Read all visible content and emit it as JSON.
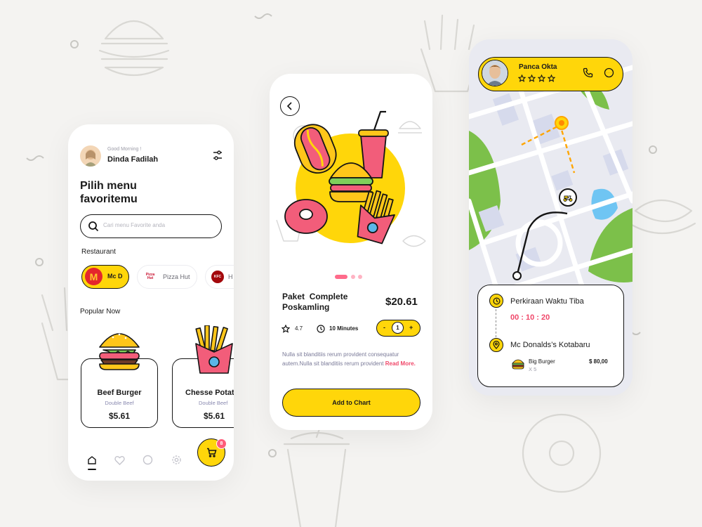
{
  "colors": {
    "accent": "#ffd60a",
    "dark": "#141414",
    "pink": "#ff4b6b",
    "muted": "#9a9aa6",
    "map_bg": "#e9eaf1",
    "park": "#7cc04a",
    "water": "#6fc5f3",
    "orange": "#ffa500"
  },
  "screen1": {
    "greeting": "Good Morning !",
    "user_name": "Dinda Fadilah",
    "title_line1": "Pilih menu",
    "title_line2": "favoritemu",
    "search_placeholder": "Cari menu Favorite anda",
    "restaurant_heading": "Restaurant",
    "restaurants": [
      {
        "logo": "M",
        "name": "Mc D",
        "selected": true
      },
      {
        "logo": "Pizza Hut",
        "name": "Pizza Hut",
        "selected": false
      },
      {
        "logo": "KFC",
        "name": "H",
        "selected": false
      }
    ],
    "popular_heading": "Popular Now",
    "products": [
      {
        "name": "Beef Burger",
        "sub": "Double Beef",
        "price": "$5.61"
      },
      {
        "name": "Chesse Potato",
        "sub": "Double Beef",
        "price": "$5.61"
      }
    ],
    "cart_badge": "8",
    "nav_icons": [
      "home-icon",
      "heart-icon",
      "chat-icon",
      "gear-icon",
      "cart-icon"
    ]
  },
  "screen2": {
    "product_title_line1": "Paket  Complete",
    "product_title_line2": "Poskamling",
    "price": "$20.61",
    "rating": "4.7",
    "time": "10 Minutes",
    "quantity": "1",
    "minus": "-",
    "plus": "+",
    "description": "Nulla sit blanditiis rerum provident consequatur autem.Nulla sit blanditiis rerum provident",
    "read_more": "Read More.",
    "cta": "Add to Chart",
    "carousel_active_index": 0,
    "carousel_count": 3
  },
  "screen3": {
    "driver_name": "Panca Okta",
    "driver_stars": 4,
    "eta_label": "Perkiraan Waktu Tiba",
    "eta_time": "00 : 10 : 20",
    "store_name": "Mc Donalds’s Kotabaru",
    "order_item": "Big Burger",
    "order_qty": "X 5",
    "order_price": "$ 80,00"
  }
}
